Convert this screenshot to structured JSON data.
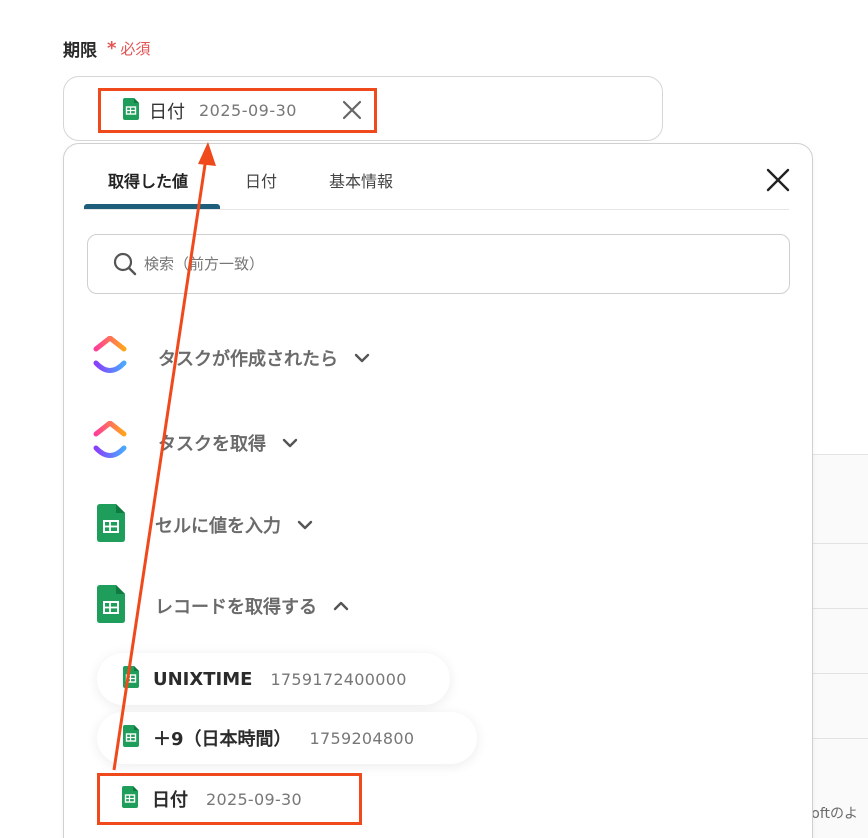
{
  "field": {
    "label": "期限",
    "asterisk": "*",
    "required": "必須",
    "chip": {
      "label": "日付",
      "value": "2025-09-30"
    }
  },
  "panel": {
    "tabs": [
      {
        "label": "取得した値"
      },
      {
        "label": "日付"
      },
      {
        "label": "基本情報"
      }
    ],
    "search_placeholder": "検索（前方一致）",
    "groups": [
      {
        "label": "タスクが作成されたら",
        "icon": "clickup-icon",
        "state": "collapsed"
      },
      {
        "label": "タスクを取得",
        "icon": "clickup-icon",
        "state": "collapsed"
      },
      {
        "label": "セルに値を入力",
        "icon": "google-sheets-icon",
        "state": "collapsed"
      },
      {
        "label": "レコードを取得する",
        "icon": "google-sheets-icon",
        "state": "expanded"
      }
    ],
    "record_items": [
      {
        "label": "UNIXTIME",
        "value": "1759172400000"
      },
      {
        "label": "＋9（日本時間）",
        "value": "1759204800"
      },
      {
        "label": "日付",
        "value": "2025-09-30"
      }
    ]
  },
  "background": {
    "partial_text": "softのよ"
  },
  "colors": {
    "highlight": "#f04a1c",
    "tab_active": "#1f5e7a",
    "required": "#e25555",
    "sheets_green": "#1e9e5a"
  }
}
